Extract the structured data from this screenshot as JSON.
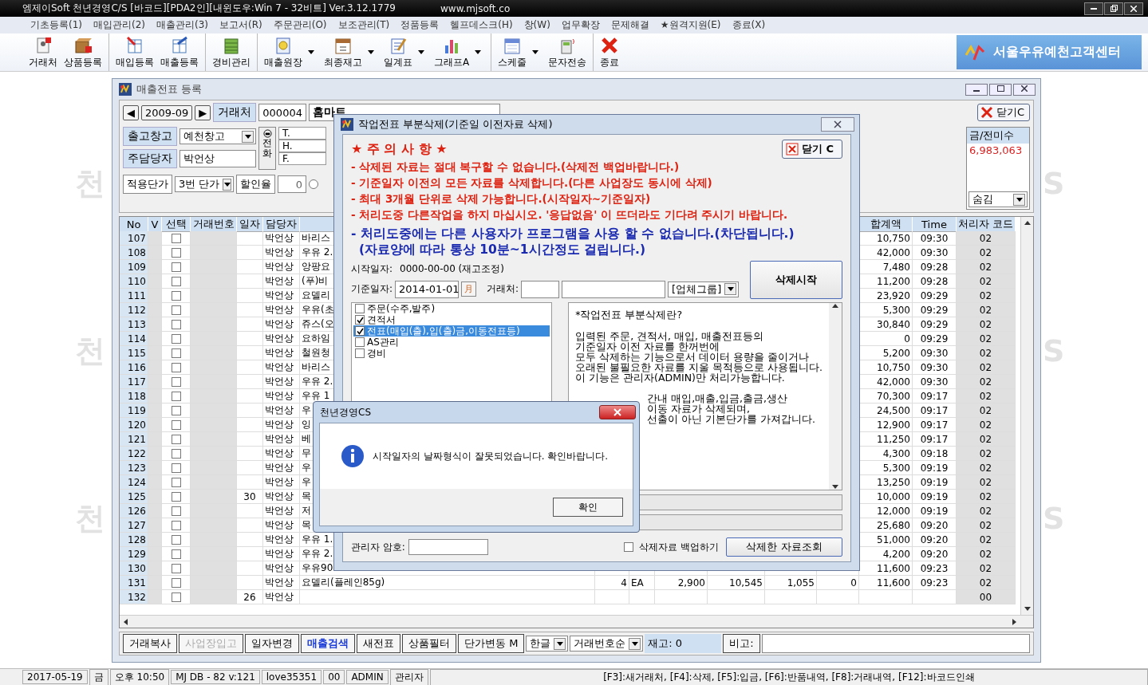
{
  "title_bar": {
    "title": "엠제이Soft 천년경영C/S [바코드][PDA2인][내윈도우:Win 7 - 32비트] Ver.3.12.1779",
    "url": "www.mjsoft.co"
  },
  "menu": [
    "기초등록(1)",
    "매입관리(2)",
    "매출관리(3)",
    "보고서(R)",
    "주문관리(O)",
    "보조관리(T)",
    "정품등록",
    "헬프데스크(H)",
    "창(W)",
    "업무확장",
    "문제해결",
    "★원격지원(E)",
    "종료(X)"
  ],
  "toolbar": [
    {
      "label": "거래처",
      "menu": false,
      "group_start": false
    },
    {
      "label": "상품등록",
      "menu": false,
      "group_start": false
    },
    {
      "label": "매입등록",
      "menu": false,
      "group_start": true
    },
    {
      "label": "매출등록",
      "menu": false,
      "group_start": false
    },
    {
      "label": "경비관리",
      "menu": false,
      "group_start": true
    },
    {
      "label": "매출원장",
      "menu": true,
      "group_start": true
    },
    {
      "label": "최종재고",
      "menu": true,
      "group_start": false
    },
    {
      "label": "일계표",
      "menu": true,
      "group_start": false
    },
    {
      "label": "그래프A",
      "menu": true,
      "group_start": false
    },
    {
      "label": "스케줄",
      "menu": true,
      "group_start": true
    },
    {
      "label": "문자전송",
      "menu": false,
      "group_start": false
    },
    {
      "label": "종료",
      "menu": false,
      "group_start": true
    }
  ],
  "banner": {
    "text": "서울우유예천고객센터"
  },
  "background_marks": {
    "left": [
      "천",
      "천",
      "천"
    ],
    "right": [
      "S",
      "S",
      "S"
    ]
  },
  "sales_window": {
    "title": "매출전표 등록",
    "period": {
      "prev": "◀",
      "value": "2009-09",
      "next": "▶"
    },
    "client": {
      "label": "거래처",
      "code": "000004",
      "name": "홈마트"
    },
    "close_button": "닫기C",
    "warehouse": {
      "label": "출고창고",
      "value": "예천창고"
    },
    "staff": {
      "label": "주담당자",
      "value": "박언상"
    },
    "phone_button": "전화",
    "contacts": [
      "T.",
      "H.",
      "F."
    ],
    "price_level": {
      "label": "적용단가",
      "value": "3번 단가"
    },
    "discount": {
      "label": "할인율",
      "value": "0",
      "selected": false
    },
    "balance": {
      "label": "금/전미수",
      "value": "6,983,063",
      "toggle": "숨김"
    },
    "columns": [
      {
        "label": "No"
      },
      {
        "label": "V"
      },
      {
        "label": "선택"
      },
      {
        "label": "거래번호"
      },
      {
        "label": "일자"
      },
      {
        "label": "담당자"
      },
      {},
      {},
      {},
      {},
      {},
      {},
      {},
      {
        "label": "합계액"
      },
      {
        "label": "Time"
      },
      {
        "label": "처리자 코드"
      }
    ],
    "rows": [
      {
        "no": "107",
        "checked": false,
        "staff": "박언상",
        "product": "바리스",
        "total": "10,750",
        "time": "09:30",
        "code": "02"
      },
      {
        "no": "108",
        "checked": false,
        "staff": "박언상",
        "product": "우유 2.",
        "total": "42,000",
        "time": "09:30",
        "code": "02"
      },
      {
        "no": "109",
        "checked": false,
        "staff": "박언상",
        "product": "앙팡요",
        "total": "7,480",
        "time": "09:28",
        "code": "02"
      },
      {
        "no": "110",
        "checked": false,
        "staff": "박언상",
        "product": "(푸)비",
        "total": "11,200",
        "time": "09:28",
        "code": "02"
      },
      {
        "no": "111",
        "checked": false,
        "staff": "박언상",
        "product": "요델리",
        "total": "23,920",
        "time": "09:29",
        "code": "02"
      },
      {
        "no": "112",
        "checked": false,
        "staff": "박언상",
        "product": "우유(초",
        "total": "5,300",
        "time": "09:29",
        "code": "02"
      },
      {
        "no": "113",
        "checked": false,
        "staff": "박언상",
        "product": "쥬스(오",
        "total": "30,840",
        "time": "09:29",
        "code": "02"
      },
      {
        "no": "114",
        "checked": false,
        "staff": "박언상",
        "product": "요하임",
        "total": "0",
        "time": "09:29",
        "code": "02"
      },
      {
        "no": "115",
        "checked": false,
        "staff": "박언상",
        "product": "철원청",
        "total": "5,200",
        "time": "09:30",
        "code": "02"
      },
      {
        "no": "116",
        "checked": false,
        "staff": "박언상",
        "product": "바리스",
        "total": "10,750",
        "time": "09:30",
        "code": "02"
      },
      {
        "no": "117",
        "checked": false,
        "staff": "박언상",
        "product": "우유 2.",
        "total": "42,000",
        "time": "09:30",
        "code": "02"
      },
      {
        "no": "118",
        "checked": false,
        "staff": "박언상",
        "product": "우유 1",
        "total": "70,300",
        "time": "09:17",
        "code": "02"
      },
      {
        "no": "119",
        "checked": false,
        "staff": "박언상",
        "product": "우",
        "total": "24,500",
        "time": "09:17",
        "code": "02"
      },
      {
        "no": "120",
        "checked": false,
        "staff": "박언상",
        "product": "잉",
        "total": "12,900",
        "time": "09:17",
        "code": "02"
      },
      {
        "no": "121",
        "checked": false,
        "staff": "박언상",
        "product": "베",
        "total": "11,250",
        "time": "09:17",
        "code": "02"
      },
      {
        "no": "122",
        "checked": false,
        "staff": "박언상",
        "product": "무",
        "total": "4,300",
        "time": "09:18",
        "code": "02"
      },
      {
        "no": "123",
        "checked": false,
        "staff": "박언상",
        "product": "우",
        "total": "5,300",
        "time": "09:19",
        "code": "02"
      },
      {
        "no": "124",
        "checked": false,
        "staff": "박언상",
        "product": "우",
        "total": "13,250",
        "time": "09:19",
        "code": "02"
      },
      {
        "no": "125",
        "checked": false,
        "date": "30",
        "staff": "박언상",
        "product": "목",
        "total": "10,000",
        "time": "09:19",
        "code": "02"
      },
      {
        "no": "126",
        "checked": false,
        "staff": "박언상",
        "product": "저",
        "total": "12,000",
        "time": "09:19",
        "code": "02"
      },
      {
        "no": "127",
        "checked": false,
        "staff": "박언상",
        "product": "목",
        "total": "25,680",
        "time": "09:20",
        "code": "02"
      },
      {
        "no": "128",
        "checked": false,
        "staff": "박언상",
        "product": "우유 1.",
        "total": "51,000",
        "time": "09:20",
        "code": "02"
      },
      {
        "no": "129",
        "checked": false,
        "staff": "박언상",
        "product": "우유 2.",
        "total": "4,200",
        "time": "09:20",
        "code": "02"
      },
      {
        "no": "130",
        "checked": false,
        "staff": "박언상",
        "product": "우유90",
        "total": "11,600",
        "time": "09:23",
        "code": "02"
      },
      {
        "no": "131",
        "checked": false,
        "staff": "박언상",
        "product": "요델리(플레인85g)",
        "details": [
          "4",
          "EA",
          "2,900",
          "10,545",
          "1,055",
          "0"
        ],
        "total": "11,600",
        "time": "09:23",
        "code": "02"
      },
      {
        "no": "132",
        "checked": false,
        "date": "26",
        "staff": "박언상",
        "code": "00"
      }
    ],
    "bottom_controls": [
      {
        "kind": "button",
        "label": "거래복사",
        "disabled": false,
        "highlight": false
      },
      {
        "kind": "button",
        "label": "사업장입고",
        "disabled": true,
        "highlight": false
      },
      {
        "kind": "button",
        "label": "일자변경",
        "disabled": false,
        "highlight": false
      },
      {
        "kind": "button",
        "label": "매출검색",
        "disabled": false,
        "highlight": true
      },
      {
        "kind": "button",
        "label": "새전표",
        "disabled": false,
        "highlight": false
      },
      {
        "kind": "button",
        "label": "상품필터",
        "disabled": false,
        "highlight": false
      },
      {
        "kind": "button",
        "label": "단가변동 M",
        "disabled": false,
        "highlight": false
      },
      {
        "kind": "dropdown",
        "label": "한글"
      },
      {
        "kind": "dropdown",
        "label": "거래번호순"
      },
      {
        "kind": "readout",
        "label": "재고: 0"
      },
      {
        "kind": "button",
        "label": "비고:",
        "disabled": false,
        "highlight": false
      },
      {
        "kind": "field"
      }
    ]
  },
  "delete_dialog": {
    "title": "작업전표 부분삭제(기준일 이전자료 삭제)",
    "warning_title": "★ 주 의 사 항 ★",
    "warnings": [
      "- 삭제된 자료는 절대 복구할 수 없습니다.(삭제전 백업바랍니다.)",
      "- 기준일자 이전의 모든 자료를 삭제합니다.(다른 사업장도 동시에 삭제)",
      "- 최대 3개월 단위로 삭제 가능합니다.(시작일자~기준일자)",
      "- 처리도중 다른작업을 하지 마십시오. '응답없음' 이 뜨더라도 기다려 주시기 바랍니다."
    ],
    "notices": [
      "- 처리도중에는 다른 사용자가 프로그램을 사용 할 수 없습니다.(차단됩니다.)",
      "(자료양에 따라 통상 10분~1시간정도 걸립니다.)"
    ],
    "close_button": "닫기 C",
    "start_date": {
      "label": "시작일자:",
      "value": "0000-00-00 (재고조정)"
    },
    "base_date": {
      "label": "기준일자:",
      "value": "2014-01-01",
      "calendar": "月"
    },
    "client_label": "거래처:",
    "group_dropdown": "[업체그룹]",
    "start_button": "삭제시작",
    "types": [
      {
        "label": "주문(수주,발주)",
        "checked": false,
        "selected": false
      },
      {
        "label": "견적서",
        "checked": true,
        "selected": false
      },
      {
        "label": "전표(매입(출),입(출)금,이동전표등)",
        "checked": true,
        "selected": true
      },
      {
        "label": "AS관리",
        "checked": false,
        "selected": false
      },
      {
        "label": "경비",
        "checked": false,
        "selected": false
      }
    ],
    "help_lines": [
      {
        "kind": "full",
        "text": "*작업전표 부분삭제란?"
      },
      {
        "kind": "full",
        "text": "입력된 주문, 견적서, 매입, 매출전표등의"
      },
      {
        "kind": "full",
        "text": "기준일자 이전 자료를 한꺼번에"
      },
      {
        "kind": "full",
        "text": "모두 삭제하는 기능으로서 데이터 용량을 줄이거나"
      },
      {
        "kind": "full",
        "text": "오래된 불필요한 자료를 지울 목적등으로 사용됩니다."
      },
      {
        "kind": "full",
        "text": "이 기능은 관리자(ADMIN)만 처리가능합니다."
      },
      {
        "kind": "cut",
        "text": "간내 매입,매출,입금,출금,생산"
      },
      {
        "kind": "cut",
        "text": "이동 자료가 삭제되며,"
      },
      {
        "kind": "cut",
        "text": "선출이 아닌 기본단가를 가져갑니다."
      }
    ],
    "password_label": "관리자 암호:",
    "backup": {
      "label": "삭제자료 백업하기",
      "checked": false
    },
    "view_button": "삭제한 자료조회"
  },
  "message_box": {
    "title": "천년경영CS",
    "text": "시작일자의 날짜형식이 잘못되었습니다. 확인바랍니다.",
    "button": "확인"
  },
  "status_bar": [
    "2017-05-19",
    "금",
    "오후 10:50",
    "MJ DB - 82 v:121",
    "love35351",
    "00",
    "ADMIN",
    "관리자",
    "[F3]:새거래처, [F4]:삭제, [F5]:입금, [F6]:반품내역, [F8]:거래내역, [F12]:바코드인쇄"
  ]
}
